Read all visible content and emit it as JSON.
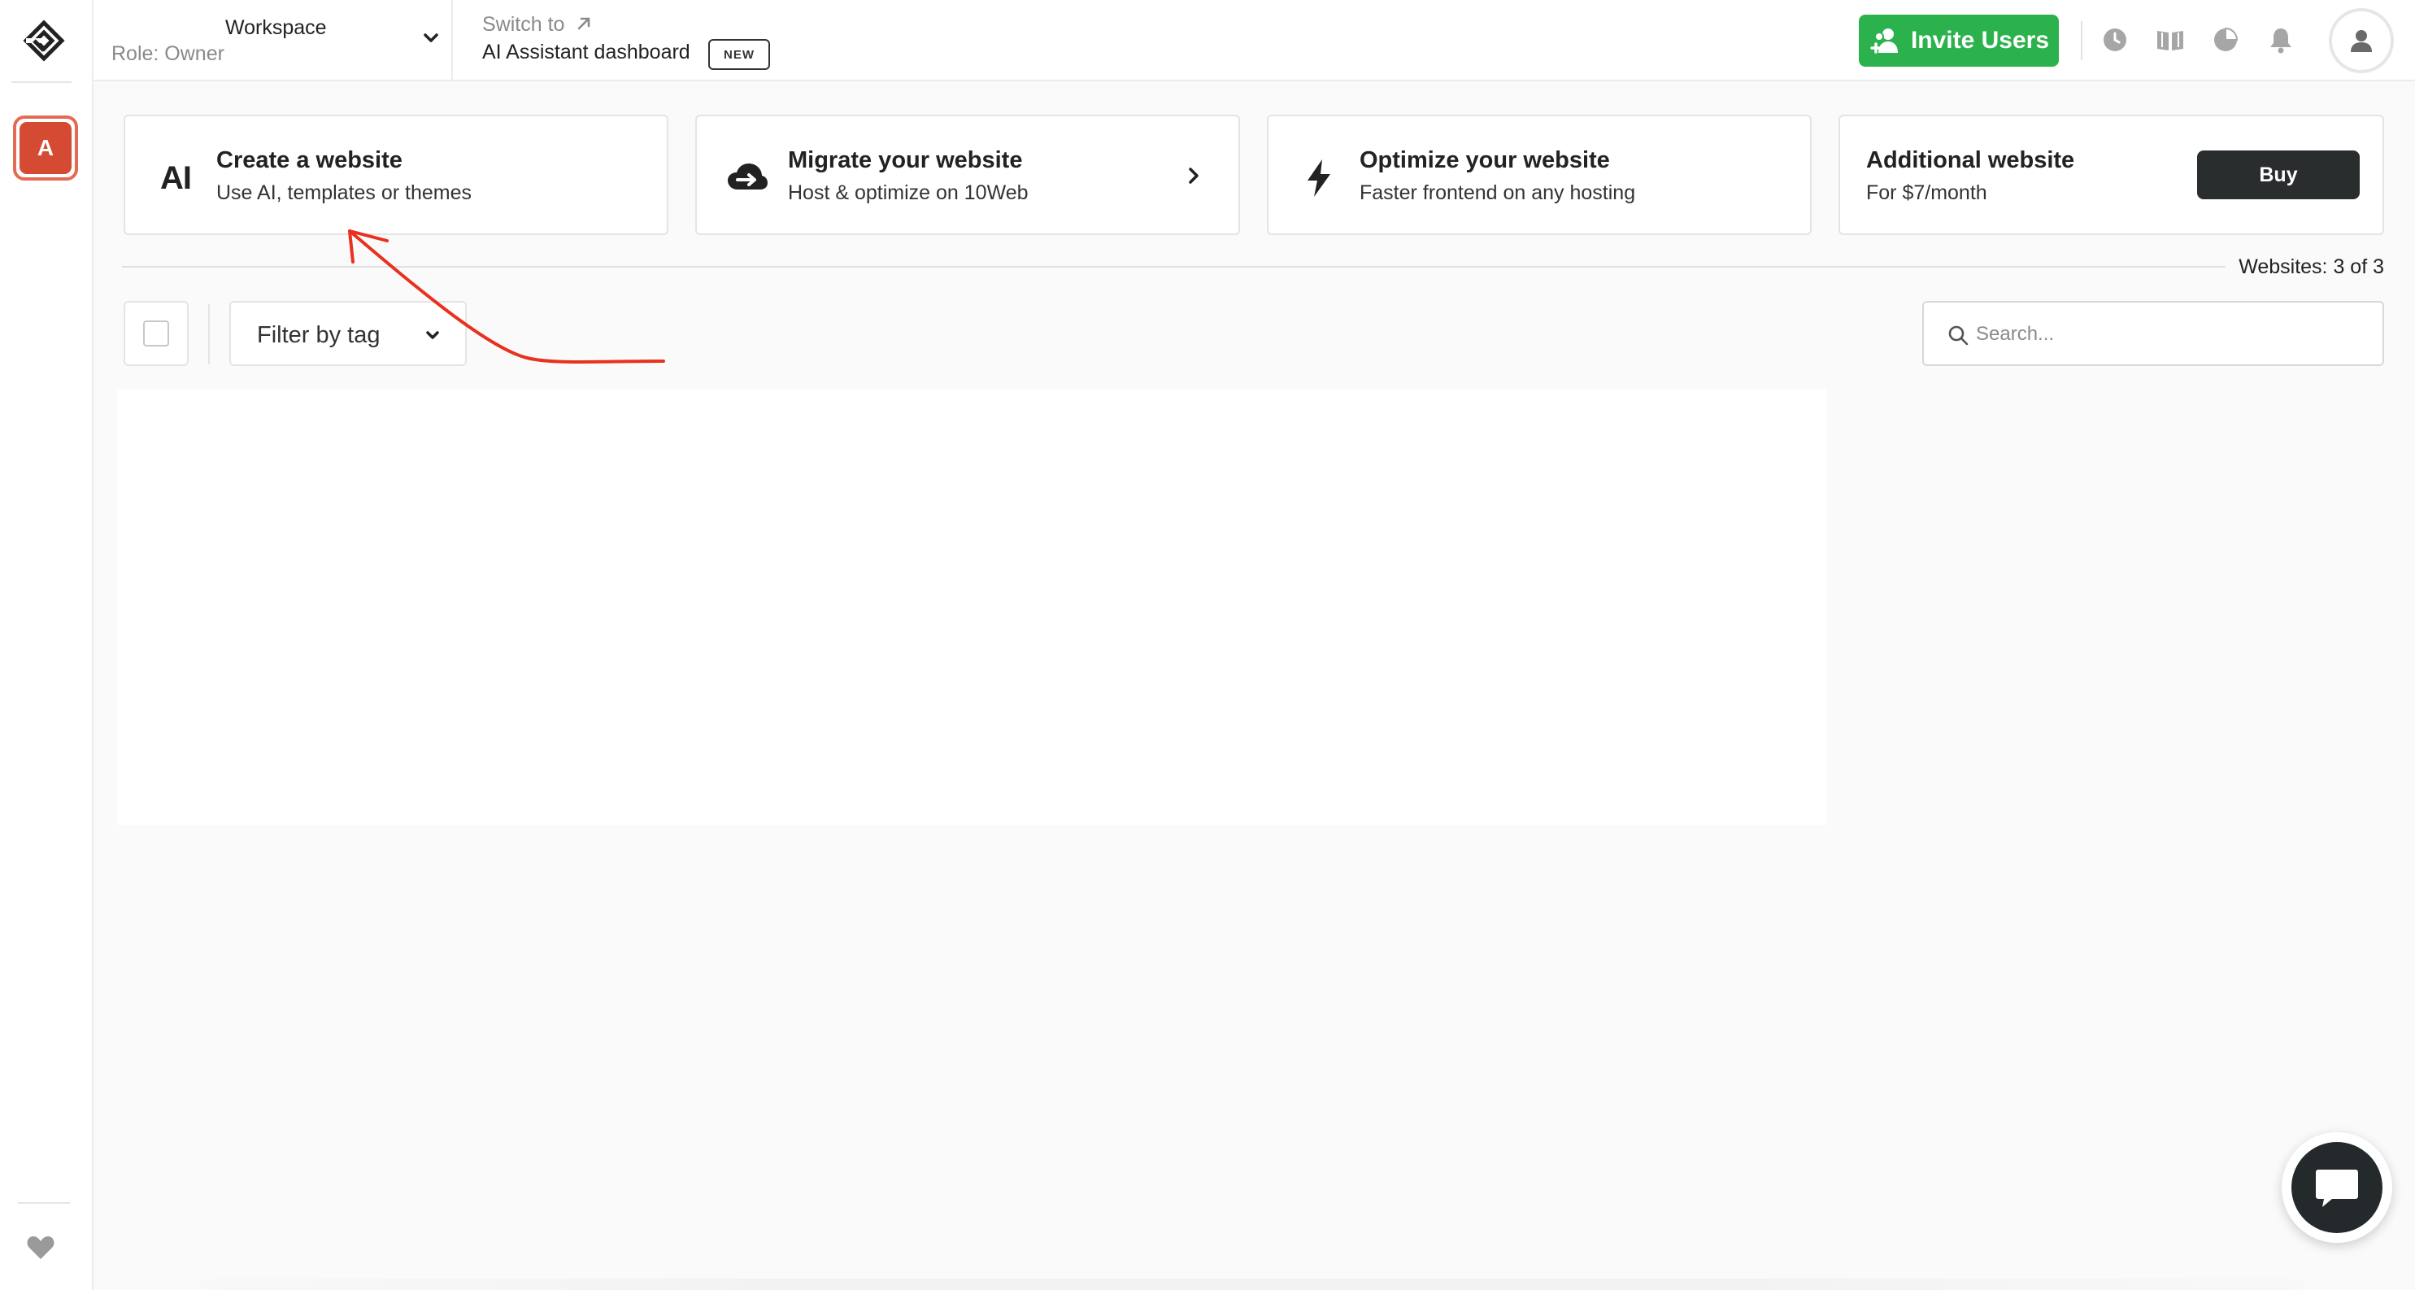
{
  "sidebar": {
    "workspace_initial": "A"
  },
  "header": {
    "workspace": {
      "title": "Workspace",
      "role": "Role: Owner"
    },
    "switch": {
      "label": "Switch to",
      "dashboard": "AI Assistant dashboard",
      "badge": "NEW"
    },
    "invite_label": "Invite Users",
    "colors": {
      "invite_bg": "#2bb24c",
      "workspace_avatar": "#d54a33"
    },
    "icons": [
      "history-icon",
      "book-icon",
      "pie-chart-icon",
      "bell-icon",
      "user-icon"
    ]
  },
  "cards": [
    {
      "icon_text": "AI",
      "title": "Create a website",
      "subtitle": "Use AI, templates or themes"
    },
    {
      "title": "Migrate your website",
      "subtitle": "Host & optimize on 10Web"
    },
    {
      "title": "Optimize your website",
      "subtitle": "Faster frontend on any hosting"
    },
    {
      "title": "Additional website",
      "subtitle": "For $7/month",
      "button": "Buy"
    }
  ],
  "websites_count": "Websites: 3 of 3",
  "filter": {
    "label": "Filter by tag"
  },
  "search": {
    "placeholder": "Search..."
  }
}
